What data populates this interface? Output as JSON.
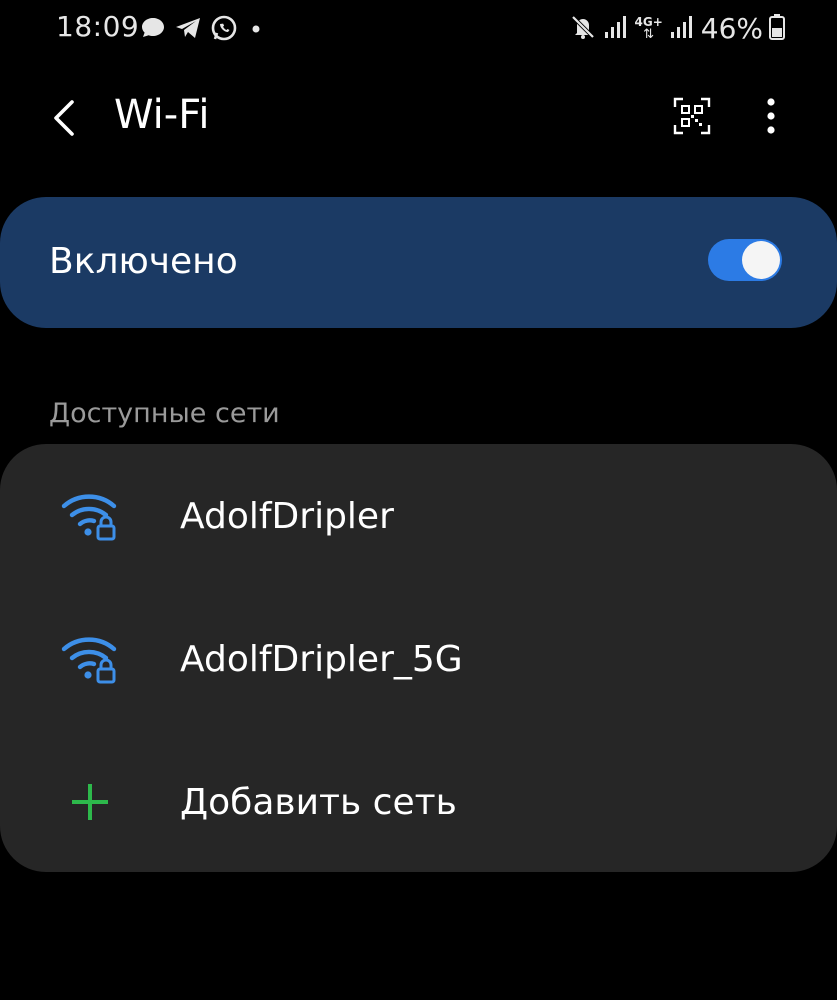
{
  "status_bar": {
    "time": "18:09",
    "battery_percent": "46%",
    "network_type": "4G+"
  },
  "header": {
    "title": "Wi-Fi"
  },
  "wifi_toggle": {
    "label": "Включено",
    "enabled": true
  },
  "available_networks": {
    "section_title": "Доступные сети",
    "networks": [
      {
        "ssid": "AdolfDripler",
        "secured": true
      },
      {
        "ssid": "AdolfDripler_5G",
        "secured": true
      }
    ],
    "add_network_label": "Добавить сеть"
  },
  "colors": {
    "background": "#000000",
    "toggle_card": "#1b3a64",
    "list_card": "#262626",
    "accent_blue": "#3d8fe8",
    "switch_on": "#2c7be5",
    "add_green": "#2db84b",
    "section_gray": "#9a9a9a"
  }
}
